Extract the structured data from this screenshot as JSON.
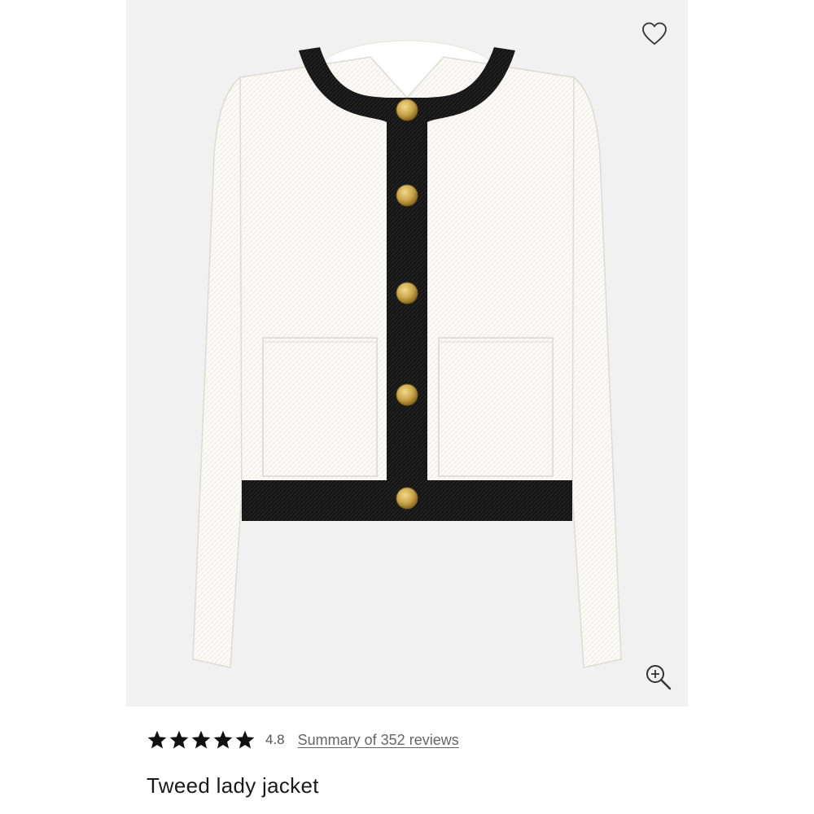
{
  "product": {
    "title": "Tweed lady jacket",
    "image_alt": "Tweed lady jacket",
    "rating": {
      "stars_filled": 5,
      "stars_total": 5,
      "value_label": "4.8",
      "reviews_link_label": "Summary of 352 reviews"
    }
  },
  "icons": {
    "wishlist": "heart-outline-icon",
    "zoom": "zoom-in-icon",
    "star": "star-filled-icon"
  },
  "colors": {
    "image_background": "#f1f1f1",
    "jacket_body": "#fbfaf6",
    "jacket_trim": "#141414",
    "button_gold": "#c9a44a",
    "star": "#111111",
    "link_text": "#666666"
  }
}
